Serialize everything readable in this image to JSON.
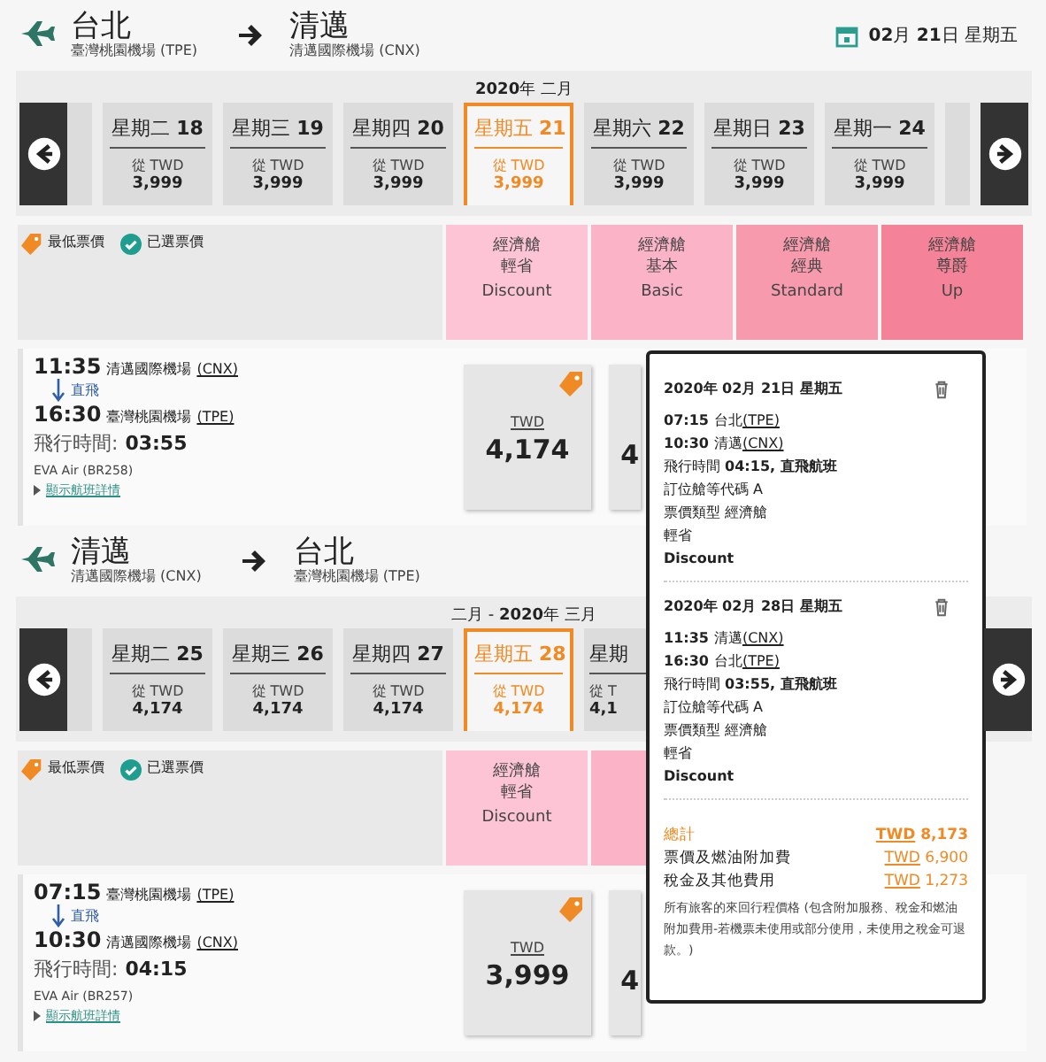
{
  "legs": [
    {
      "from": {
        "city": "台北",
        "airport": "臺灣桃園機場 (TPE)"
      },
      "to": {
        "city": "清邁",
        "airport": "清邁國際機場 (CNX)"
      },
      "date": "**02**月 **21**日 星期五",
      "month_label": "**2020**年 二月",
      "days": [
        {
          "weekday": "星期二",
          "day": "18",
          "from_label": "從 TWD",
          "price": "3,999",
          "selected": false
        },
        {
          "weekday": "星期三",
          "day": "19",
          "from_label": "從 TWD",
          "price": "3,999",
          "selected": false
        },
        {
          "weekday": "星期四",
          "day": "20",
          "from_label": "從 TWD",
          "price": "3,999",
          "selected": false
        },
        {
          "weekday": "星期五",
          "day": "21",
          "from_label": "從 TWD",
          "price": "3,999",
          "selected": true
        },
        {
          "weekday": "星期六",
          "day": "22",
          "from_label": "從 TWD",
          "price": "3,999",
          "selected": false
        },
        {
          "weekday": "星期日",
          "day": "23",
          "from_label": "從 TWD",
          "price": "3,999",
          "selected": false
        },
        {
          "weekday": "星期一",
          "day": "24",
          "from_label": "從 TWD",
          "price": "3,999",
          "selected": false
        }
      ],
      "legend": [
        {
          "kind": "lowest",
          "label": "最低票價"
        },
        {
          "kind": "selected",
          "label": "已選票價"
        }
      ],
      "fare_classes": [
        {
          "cabin": "經濟艙",
          "name": "輕省",
          "en": "Discount",
          "color": "#fcc4d4"
        },
        {
          "cabin": "經濟艙",
          "name": "基本",
          "en": "Basic",
          "color": "#fbb3c8"
        },
        {
          "cabin": "經濟艙",
          "name": "經典",
          "en": "Standard",
          "color": "#f79aae"
        },
        {
          "cabin": "經濟艙",
          "name": "尊爵",
          "en": "Up",
          "color": "#f48399"
        }
      ],
      "flight": {
        "depart_time": "11:35",
        "depart_airport": "清邁國際機場",
        "depart_code": "(CNX)",
        "stop": "直飛",
        "arrive_time": "16:30",
        "arrive_airport": "臺灣桃園機場",
        "arrive_code": "(TPE)",
        "duration_label": "飛行時間:",
        "duration": "03:55",
        "airline": "EVA Air (BR258)",
        "details_link": "顯示航班詳情",
        "fares": [
          {
            "currency": "TWD",
            "price": "4,174",
            "lowest": true
          },
          {
            "price": "4",
            "lowest": false
          }
        ]
      }
    },
    {
      "from": {
        "city": "清邁",
        "airport": "清邁國際機場 (CNX)"
      },
      "to": {
        "city": "台北",
        "airport": "臺灣桃園機場 (TPE)"
      },
      "month_label": "二月 - **2020**年 三月",
      "days": [
        {
          "weekday": "星期二",
          "day": "25",
          "from_label": "從 TWD",
          "price": "4,174",
          "selected": false
        },
        {
          "weekday": "星期三",
          "day": "26",
          "from_label": "從 TWD",
          "price": "4,174",
          "selected": false
        },
        {
          "weekday": "星期四",
          "day": "27",
          "from_label": "從 TWD",
          "price": "4,174",
          "selected": false
        },
        {
          "weekday": "星期五",
          "day": "28",
          "from_label": "從 TWD",
          "price": "4,174",
          "selected": true
        },
        {
          "weekday": "星期",
          "from_label": "從 T",
          "price": "4,1",
          "selected": false
        }
      ],
      "legend": [
        {
          "kind": "lowest",
          "label": "最低票價"
        },
        {
          "kind": "selected",
          "label": "已選票價"
        }
      ],
      "fare_classes": [
        {
          "cabin": "經濟艙",
          "name": "輕省",
          "en": "Discount",
          "color": "#fcc4d4"
        },
        {
          "color": "#fbb3c8"
        }
      ],
      "flight": {
        "depart_time": "07:15",
        "depart_airport": "臺灣桃園機場",
        "depart_code": "(TPE)",
        "stop": "直飛",
        "arrive_time": "10:30",
        "arrive_airport": "清邁國際機場",
        "arrive_code": "(CNX)",
        "duration_label": "飛行時間:",
        "duration": "04:15",
        "airline": "EVA Air (BR257)",
        "details_link": "顯示航班詳情",
        "fares": [
          {
            "currency": "TWD",
            "price": "3,999",
            "lowest": true
          },
          {
            "price": "4",
            "lowest": false
          }
        ]
      }
    }
  ],
  "summary": {
    "segments": [
      {
        "date": "2020年 02月 21日 星期五",
        "stops": [
          {
            "time": "07:15",
            "place": "台北",
            "code": "(TPE)"
          },
          {
            "time": "10:30",
            "place": "清邁",
            "code": "(CNX)"
          }
        ],
        "lines": [
          "飛行時間 **04:15, 直飛航班**",
          "訂位艙等代碼 A",
          "票價類型 經濟艙",
          "輕省"
        ],
        "fare_en": "Discount"
      },
      {
        "date": "2020年 02月 28日 星期五",
        "stops": [
          {
            "time": "11:35",
            "place": "清邁",
            "code": "(CNX)"
          },
          {
            "time": "16:30",
            "place": "台北",
            "code": "(TPE)"
          }
        ],
        "lines": [
          "飛行時間 **03:55, 直飛航班**",
          "訂位艙等代碼 A",
          "票價類型 經濟艙",
          "輕省"
        ],
        "fare_en": "Discount"
      }
    ],
    "totals": [
      {
        "kind": "total",
        "label": "總計",
        "currency": "TWD",
        "amount": "8,173"
      },
      {
        "kind": "item",
        "label": "票價及燃油附加費",
        "currency": "TWD",
        "amount": "6,900"
      },
      {
        "kind": "item",
        "label": "稅金及其他費用",
        "currency": "TWD",
        "amount": "1,273"
      }
    ],
    "note": "所有旅客的來回行程價格 (包含附加服務、稅金和燃油附加費用-若機票未使用或部分使用，未使用之稅金可退款。)"
  }
}
